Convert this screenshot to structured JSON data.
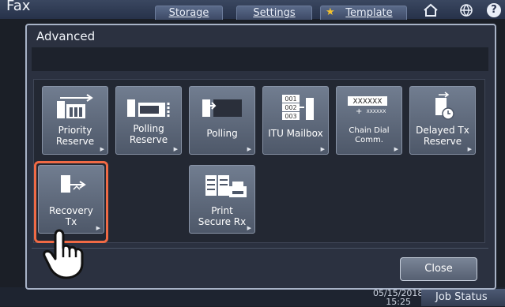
{
  "app": {
    "title": "Fax"
  },
  "tabs": [
    {
      "label": "Storage"
    },
    {
      "label": "Settings"
    },
    {
      "label": "Template"
    }
  ],
  "icons": {
    "home": "home-icon",
    "language": "globe-icon",
    "help": "help-icon",
    "template": "star-icon"
  },
  "help_glyph": "?",
  "dialog": {
    "title": "Advanced",
    "buttons": [
      {
        "line1": "Priority",
        "line2": "Reserve",
        "icon": "priority-reserve-icon"
      },
      {
        "line1": "Polling",
        "line2": "Reserve",
        "icon": "polling-reserve-icon"
      },
      {
        "line1": "Polling",
        "line2": "",
        "icon": "polling-icon"
      },
      {
        "line1": "ITU Mailbox",
        "line2": "",
        "icon": "itu-mailbox-icon",
        "icon_text": [
          "001",
          "002",
          "003"
        ]
      },
      {
        "line1": "Chain Dial",
        "line2": "Comm.",
        "icon": "chain-dial-icon",
        "icon_text": [
          "XXXXXX",
          "XXXXXX"
        ]
      },
      {
        "line1": "Delayed Tx",
        "line2": "Reserve",
        "icon": "delayed-tx-icon"
      },
      {
        "line1": "Recovery",
        "line2": "Tx",
        "icon": "recovery-tx-icon",
        "selected": true
      },
      {
        "line1": "Print",
        "line2": "Secure Rx",
        "icon": "print-secure-rx-icon"
      }
    ],
    "close_label": "Close"
  },
  "status": {
    "date": "05/15/2018",
    "time": "15:25",
    "job_status_label": "Job Status"
  },
  "colors": {
    "highlight": "#f06a45",
    "template_star": "#f3c12e"
  }
}
